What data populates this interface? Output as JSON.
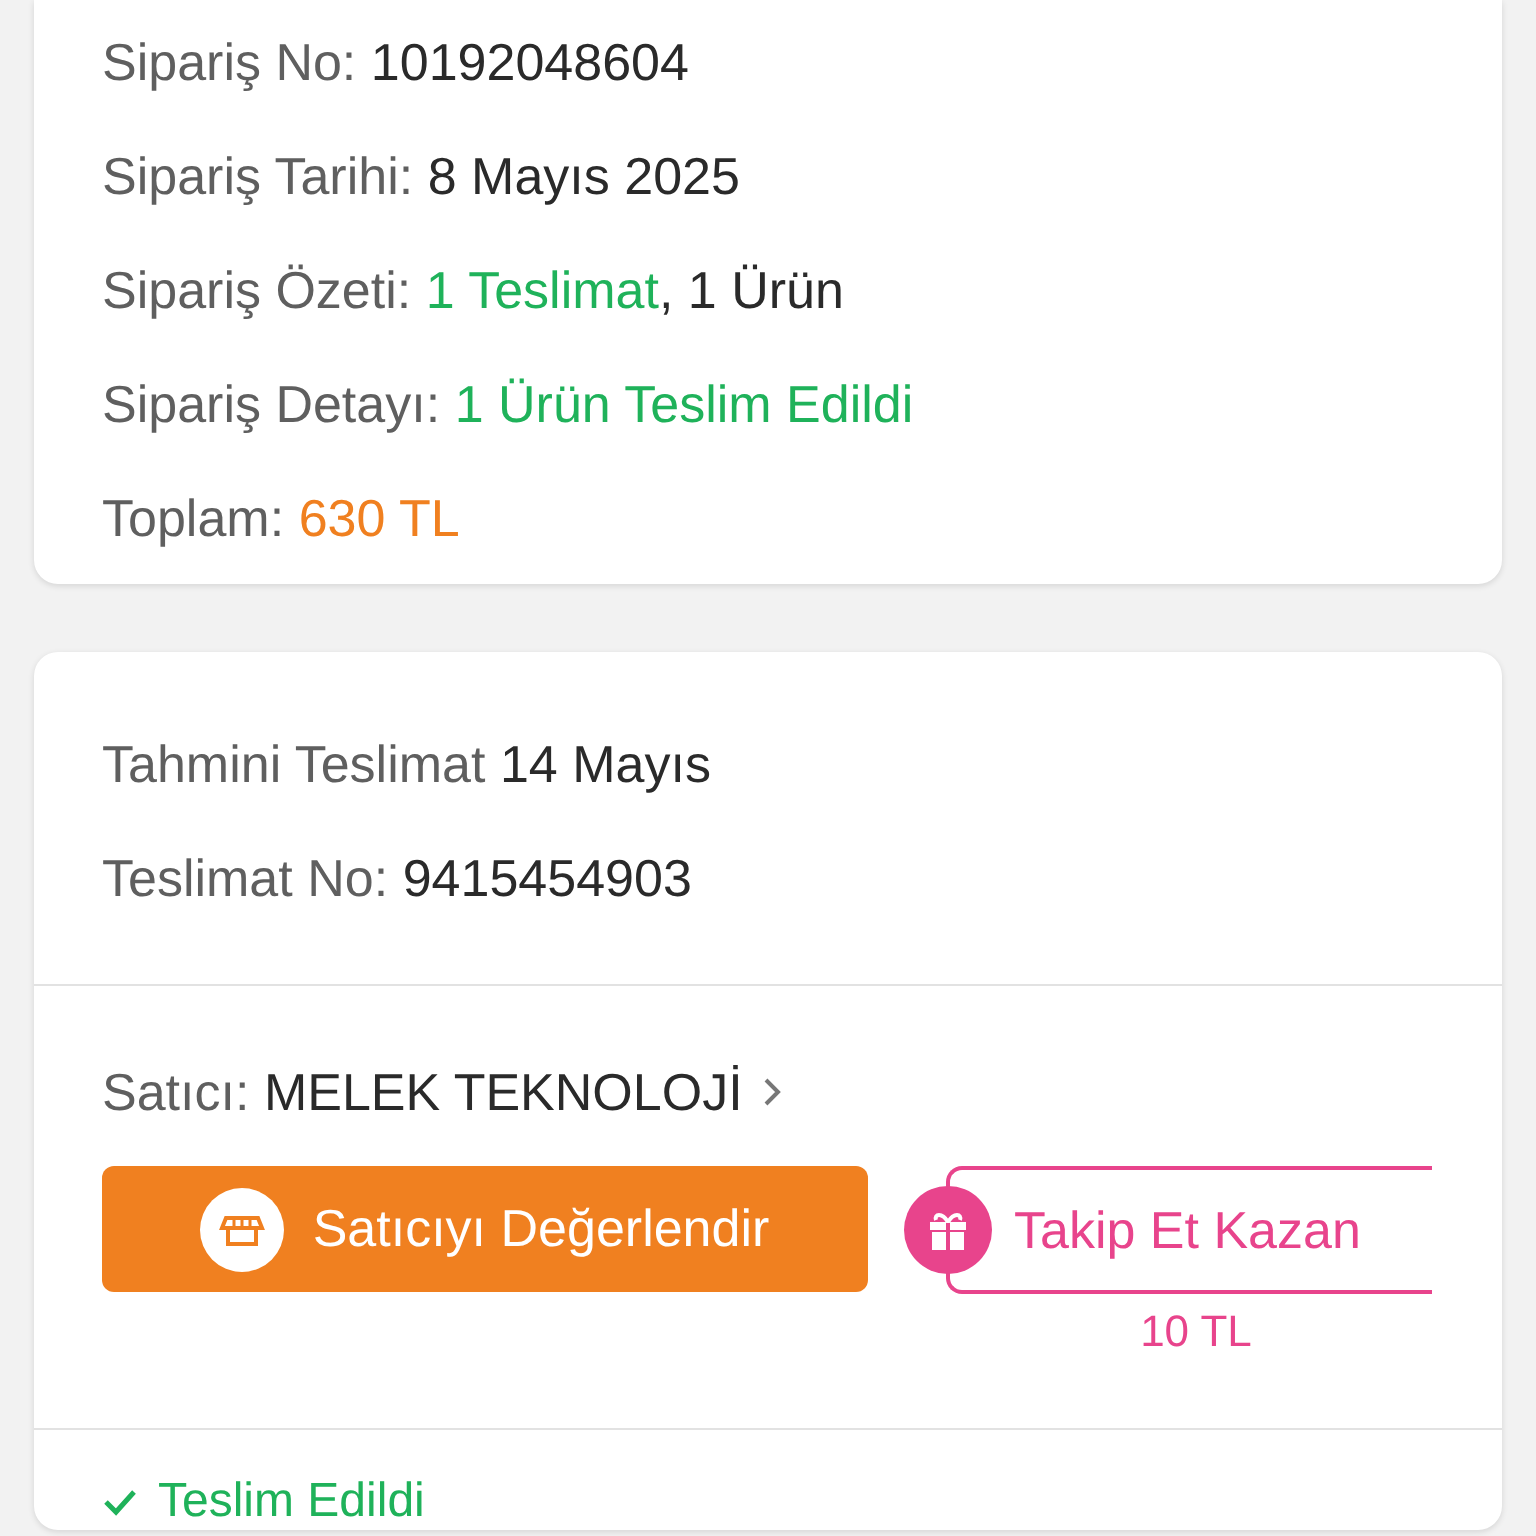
{
  "order_summary": {
    "lines": [
      {
        "parts": [
          {
            "kind": "label",
            "text": "Sipariş No:"
          },
          {
            "kind": "value",
            "text": "10192048604"
          }
        ]
      },
      {
        "parts": [
          {
            "kind": "label",
            "text": "Sipariş Tarihi:"
          },
          {
            "kind": "value",
            "text": "8 Mayıs 2025"
          }
        ]
      },
      {
        "parts": [
          {
            "kind": "label",
            "text": "Sipariş Özeti:"
          },
          {
            "kind": "green",
            "text": "1 Teslimat"
          },
          {
            "kind": "value",
            "text": ", 1 Ürün",
            "joined": true
          }
        ]
      },
      {
        "parts": [
          {
            "kind": "label",
            "text": "Sipariş Detayı:"
          },
          {
            "kind": "green",
            "text": "1 Ürün Teslim Edildi"
          }
        ]
      },
      {
        "parts": [
          {
            "kind": "label",
            "text": "Toplam:"
          },
          {
            "kind": "orange",
            "text": "630 TL"
          }
        ]
      }
    ]
  },
  "delivery": {
    "lines": [
      {
        "parts": [
          {
            "kind": "label",
            "text": "Tahmini Teslimat"
          },
          {
            "kind": "value",
            "text": "14 Mayıs"
          }
        ]
      },
      {
        "parts": [
          {
            "kind": "label",
            "text": "Teslimat No:"
          },
          {
            "kind": "value",
            "text": "9415454903"
          }
        ]
      }
    ],
    "seller": {
      "label": "Satıcı:",
      "name": "MELEK TEKNOLOJİ"
    },
    "rate_button": "Satıcıyı Değerlendir",
    "follow_button": "Takip Et Kazan",
    "follow_reward": "10 TL",
    "status": "Teslim Edildi"
  }
}
